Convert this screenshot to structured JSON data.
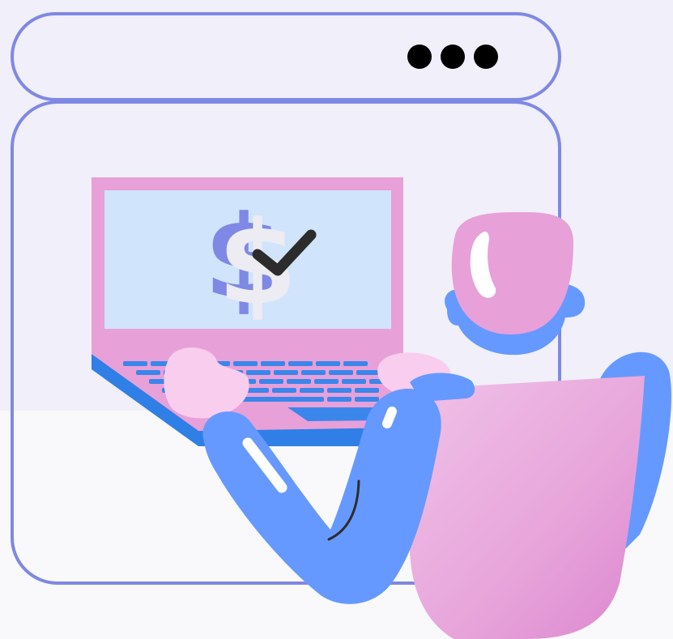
{
  "illustration": {
    "browser_dots": [
      "dot-1",
      "dot-2",
      "dot-3"
    ],
    "screen_symbol": "$",
    "icons": [
      "dollar-sign-icon",
      "checkmark-icon",
      "ellipsis-icon"
    ]
  },
  "colors": {
    "outline": "#7f88e4",
    "page_bg_top": "#f0effa",
    "page_bg_bottom": "#f9f9fb",
    "laptop_pink": "#e7a0d8",
    "laptop_screen": "#d0e4fc",
    "laptop_base_blue": "#2f7fe6",
    "keyboard_blue": "#3a86ea",
    "sleeve_blue": "#6699ff",
    "body_pink": "#e9a6dc",
    "skin_light_pink": "#f9cdee",
    "dollar_white": "#ececf2",
    "dollar_shadow": "#7f88e4",
    "check_dark": "#2c2c2c",
    "dot_black": "#000000"
  }
}
